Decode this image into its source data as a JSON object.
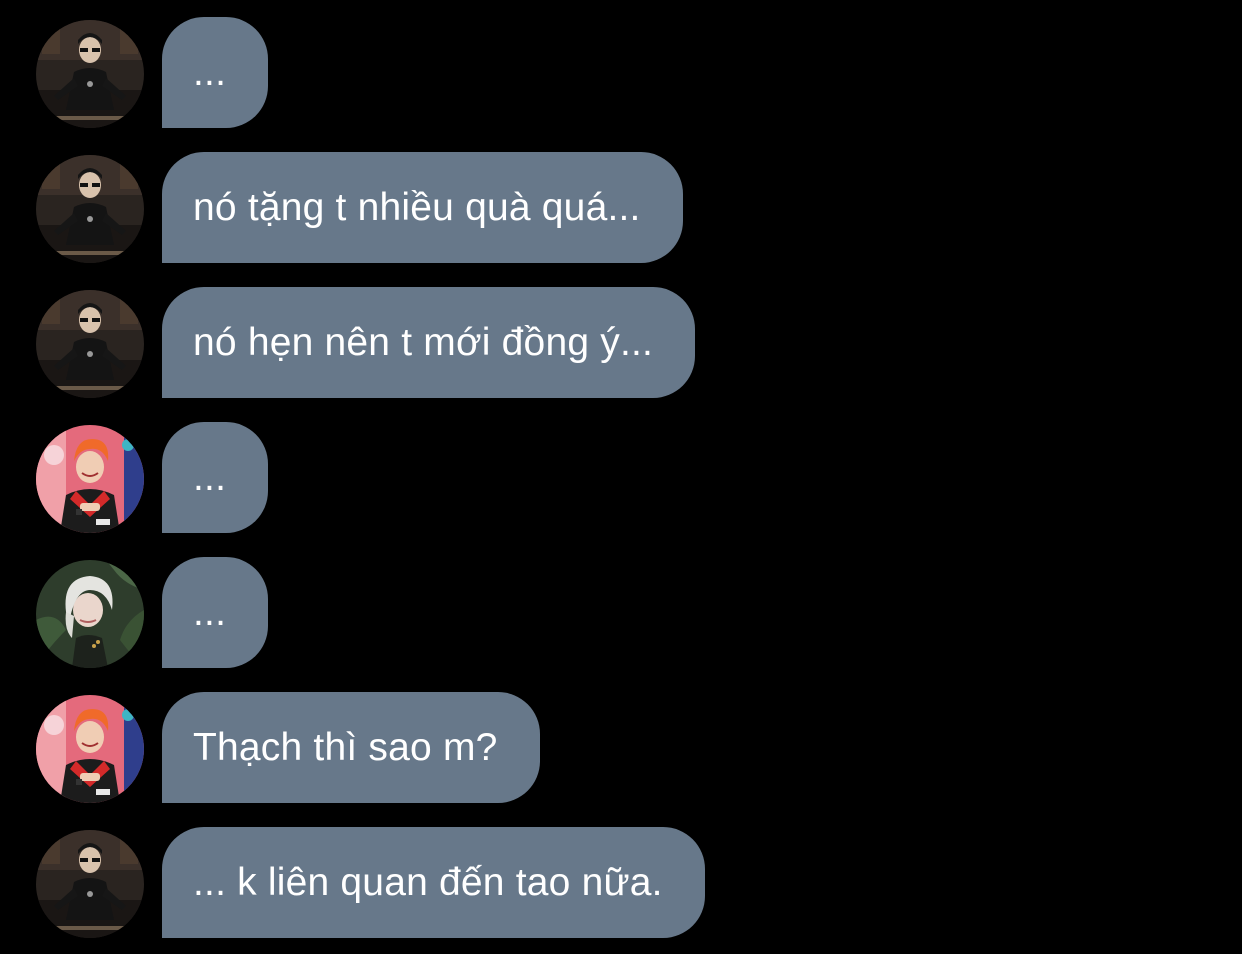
{
  "palette": {
    "background": "#000000",
    "bubble": "#67788a",
    "bubble_text": "#ffffff"
  },
  "messages": [
    {
      "sender": "avatar-dark-glasses",
      "text": "..."
    },
    {
      "sender": "avatar-dark-glasses",
      "text": "nó tặng t nhiều quà quá..."
    },
    {
      "sender": "avatar-dark-glasses",
      "text": "nó hẹn nên t mới đồng ý..."
    },
    {
      "sender": "avatar-orange-hair",
      "text": "..."
    },
    {
      "sender": "avatar-silver-hair",
      "text": "..."
    },
    {
      "sender": "avatar-orange-hair",
      "text": "Thạch thì sao m?"
    },
    {
      "sender": "avatar-dark-glasses",
      "text": "... k liên quan đến tao nữa."
    }
  ]
}
